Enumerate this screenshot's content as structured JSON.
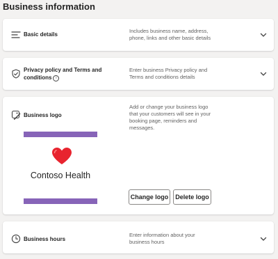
{
  "page": {
    "title": "Business information"
  },
  "sections": {
    "basic": {
      "title": "Basic details",
      "description_lines": [
        "Includes business name, address,",
        "phone, links and other basic details"
      ]
    },
    "privacy": {
      "title_lines": [
        "Privacy policy and Terms and",
        "conditions"
      ],
      "info_icon": "i",
      "description_lines": [
        "Enter business Privacy policy and",
        "Terms and conditions details"
      ]
    },
    "logo": {
      "title": "Business logo",
      "description_lines": [
        "Add or change your business logo",
        "that your customers will see in your",
        "booking page, reminders and",
        "messages."
      ],
      "preview": {
        "business_name": "Contoso Health",
        "bar_color": "#8764b8",
        "heart_color": "#e8242f"
      },
      "change_label": "Change logo",
      "delete_label": "Delete logo"
    },
    "hours": {
      "title": "Business hours",
      "description_lines": [
        "Enter information about your",
        "business hours"
      ]
    }
  },
  "icons": {
    "basic": "text-lines-icon",
    "privacy": "shield-check-icon",
    "logo": "image-edit-icon",
    "hours": "clock-icon",
    "expand": "chevron-down-icon"
  }
}
